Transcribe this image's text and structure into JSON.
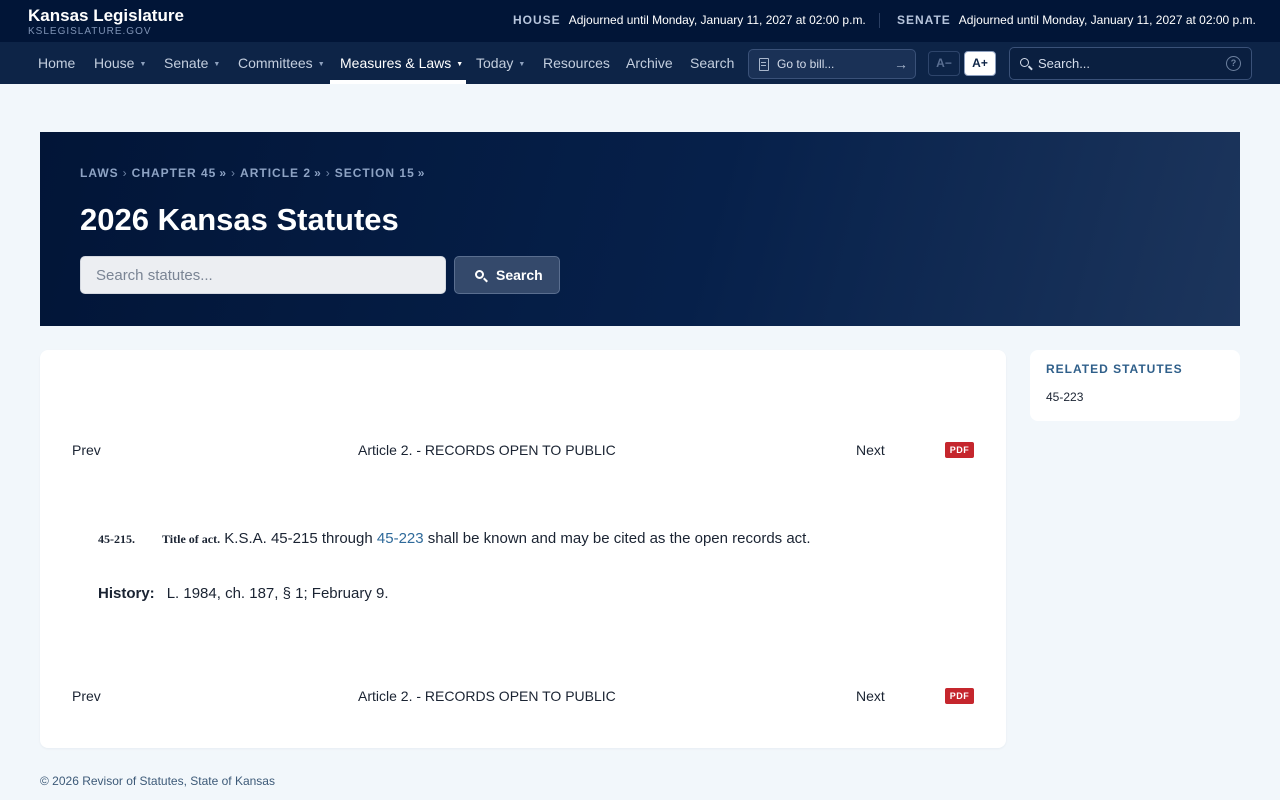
{
  "brand": {
    "title": "Kansas Legislature",
    "subtitle": "KSLEGISLATURE.GOV"
  },
  "status": {
    "house": {
      "label": "HOUSE",
      "text": "Adjourned until Monday, January 11, 2027 at 02:00 p.m."
    },
    "senate": {
      "label": "SENATE",
      "text": "Adjourned until Monday, January 11, 2027 at 02:00 p.m."
    }
  },
  "nav": {
    "items": [
      {
        "label": "Home"
      },
      {
        "label": "House"
      },
      {
        "label": "Senate"
      },
      {
        "label": "Committees"
      },
      {
        "label": "Measures & Laws"
      },
      {
        "label": "Today"
      },
      {
        "label": "Resources"
      },
      {
        "label": "Archive"
      },
      {
        "label": "Search"
      }
    ],
    "go_to_bill_placeholder": "Go to bill...",
    "font_decrease": "A−",
    "font_increase": "A+",
    "search_placeholder": "Search...",
    "help": "?"
  },
  "hero": {
    "breadcrumb": [
      "LAWS",
      "CHAPTER 45",
      "ARTICLE 2",
      "SECTION 15"
    ],
    "title": "2026 Kansas Statutes",
    "search_placeholder": "Search statutes...",
    "search_button": "Search"
  },
  "statute_nav": {
    "prev": "Prev",
    "article": "Article 2. - RECORDS OPEN TO PUBLIC",
    "next": "Next",
    "pdf": "PDF"
  },
  "statute": {
    "number": "45-215.",
    "title": "Title of act.",
    "text_before": "K.S.A. 45-215 through",
    "link": "45-223",
    "text_after": "shall be known and may be cited as the open records act.",
    "history_label": "History:",
    "history_text": "L. 1984, ch. 187, § 1; February 9."
  },
  "related": {
    "title": "RELATED STATUTES",
    "items": [
      "45-223"
    ]
  },
  "footer": {
    "text": "© 2026 Revisor of Statutes, State of Kansas"
  }
}
